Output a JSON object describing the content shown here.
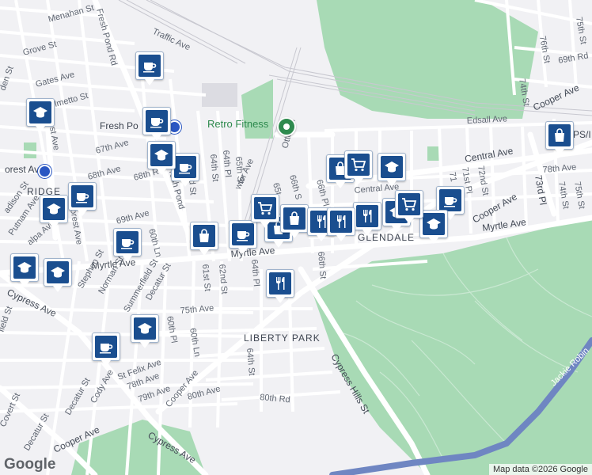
{
  "map": {
    "neighborhoods": {
      "glendale": "GLENDALE",
      "liberty_park": "LIBERTY PARK",
      "ridgewood": "RIDGE"
    },
    "places": {
      "gym": "Retro Fitness",
      "station_fresh_pond": "Fresh Po",
      "station_forest": "orest Av",
      "ps": "PS/I"
    },
    "streets": {
      "myrtle_ave_w": "Myrtle Ave",
      "myrtle_ave_c": "Myrtle Ave",
      "myrtle_ave_e": "Myrtle Ave",
      "cooper_ave_sw": "Cooper Ave",
      "cooper_ave_mid": "Cooper Ave",
      "cooper_ave_e": "Cooper Ave",
      "cooper_ave_ne": "Cooper Ave",
      "cypress_ave_w": "Cypress Ave",
      "cypress_ave_sw": "Cypress Ave",
      "cypress_hills_st": "Cypress Hills St",
      "central_ave_w": "Central Ave",
      "central_ave_e": "Central Ave",
      "edsall_ave": "Edsall Ave",
      "fresh_pond_rd_n": "Fresh Pond Rd",
      "fresh_pond_rd_s": "Fresh Pond",
      "menahan_st": "Menahan St",
      "traffic_ave": "Traffic Ave",
      "grove_st": "Grove St",
      "gates_ave": "Gates Ave",
      "metto_st": "lmetto St",
      "67th_ave": "67th Ave",
      "68th_ave": "68th Ave",
      "68th_rd": "68th R",
      "69th_ave": "69th Ave",
      "75th_ave": "75th Ave",
      "78th_ave_w": "78th Ave",
      "79th_ave": "79th Ave",
      "80th_ave": "80th Ave",
      "80th_rd": "80th Rd",
      "78th_ave_e": "78th Ave",
      "69th_rd": "69th Rd",
      "otto_rd": "Otto Rd",
      "64th_st_n": "64th St",
      "65th_st": "65th St",
      "64th_pl_n": "64th Pl",
      "64th_pl_s": "64th Pl",
      "64th_st_s": "64th St",
      "66th_st": "66th St",
      "66th_pl": "66th Pl",
      "66th_s": "66th S",
      "65t": "65t",
      "62nd_st": "62nd St",
      "61st_st": "61st St",
      "60th_ln_n": "60th Ln",
      "60th_ln_s": "60th Ln",
      "60th_pl": "60th Pl",
      "60th_st": "60th St",
      "2nd_st": "2nd St",
      "decatur_st_n": "Decatur St",
      "decatur_st_s": "Decatur St",
      "decatur_st_sw": "Decatur St",
      "summerfield_st": "Summerfield St",
      "norman_st": "Norman St",
      "stephen_st": "Stephen St",
      "st_felix_ave": "St Felix Ave",
      "cody_ave": "Cody Ave",
      "covert_st": "Covert St",
      "forest_ave_n": "est Ave",
      "forest_ave_s": "Forest Ave",
      "putnam_ave": "Putnam Ave",
      "adison_st": "adison St",
      "alpa_ave": "alpa Ave",
      "den_st": "den St",
      "field_st": "field St",
      "76th_st": "76th St",
      "74th_st_n": "74th St",
      "74th_st_s": "74th St",
      "73rd_pl": "73rd Pl",
      "72nd_st": "72nd St",
      "71st_pl": "71st Pl",
      "71": "71",
      "75th_st": "75th St",
      "wler_ave": "wler Ave",
      "jackie_robinson": "Jackie Robin"
    },
    "attribution": "Map data ©2026 Google",
    "logo": "Google"
  },
  "markers": [
    {
      "type": "coffee",
      "icon": "coffee-cup-icon"
    },
    {
      "type": "coffee",
      "icon": "coffee-cup-icon"
    },
    {
      "type": "coffee",
      "icon": "coffee-cup-icon"
    },
    {
      "type": "coffee",
      "icon": "coffee-cup-icon"
    },
    {
      "type": "coffee",
      "icon": "coffee-cup-icon"
    },
    {
      "type": "coffee",
      "icon": "coffee-cup-icon"
    },
    {
      "type": "coffee",
      "icon": "coffee-cup-icon"
    },
    {
      "type": "coffee",
      "icon": "coffee-cup-icon"
    },
    {
      "type": "school",
      "icon": "graduation-cap-icon"
    },
    {
      "type": "school",
      "icon": "graduation-cap-icon"
    },
    {
      "type": "school",
      "icon": "graduation-cap-icon"
    },
    {
      "type": "school",
      "icon": "graduation-cap-icon"
    },
    {
      "type": "school",
      "icon": "graduation-cap-icon"
    },
    {
      "type": "school",
      "icon": "graduation-cap-icon"
    },
    {
      "type": "school",
      "icon": "graduation-cap-icon"
    },
    {
      "type": "school",
      "icon": "graduation-cap-icon"
    },
    {
      "type": "school",
      "icon": "graduation-cap-icon"
    },
    {
      "type": "shopping",
      "icon": "shopping-bag-icon"
    },
    {
      "type": "shopping",
      "icon": "shopping-bag-icon"
    },
    {
      "type": "shopping",
      "icon": "shopping-bag-icon"
    },
    {
      "type": "shopping",
      "icon": "shopping-bag-icon"
    },
    {
      "type": "shopping",
      "icon": "shopping-bag-icon"
    },
    {
      "type": "grocery",
      "icon": "shopping-cart-icon"
    },
    {
      "type": "grocery",
      "icon": "shopping-cart-icon"
    },
    {
      "type": "grocery",
      "icon": "shopping-cart-icon"
    },
    {
      "type": "restaurant",
      "icon": "fork-knife-icon"
    },
    {
      "type": "restaurant",
      "icon": "fork-knife-icon"
    },
    {
      "type": "restaurant",
      "icon": "fork-knife-icon"
    },
    {
      "type": "restaurant",
      "icon": "fork-knife-icon"
    }
  ],
  "colors": {
    "park": "#a8dab5",
    "road": "#ffffff",
    "highway": "#ffffff",
    "marker": "#1a4e8f",
    "water_road": "#6f86c2"
  }
}
